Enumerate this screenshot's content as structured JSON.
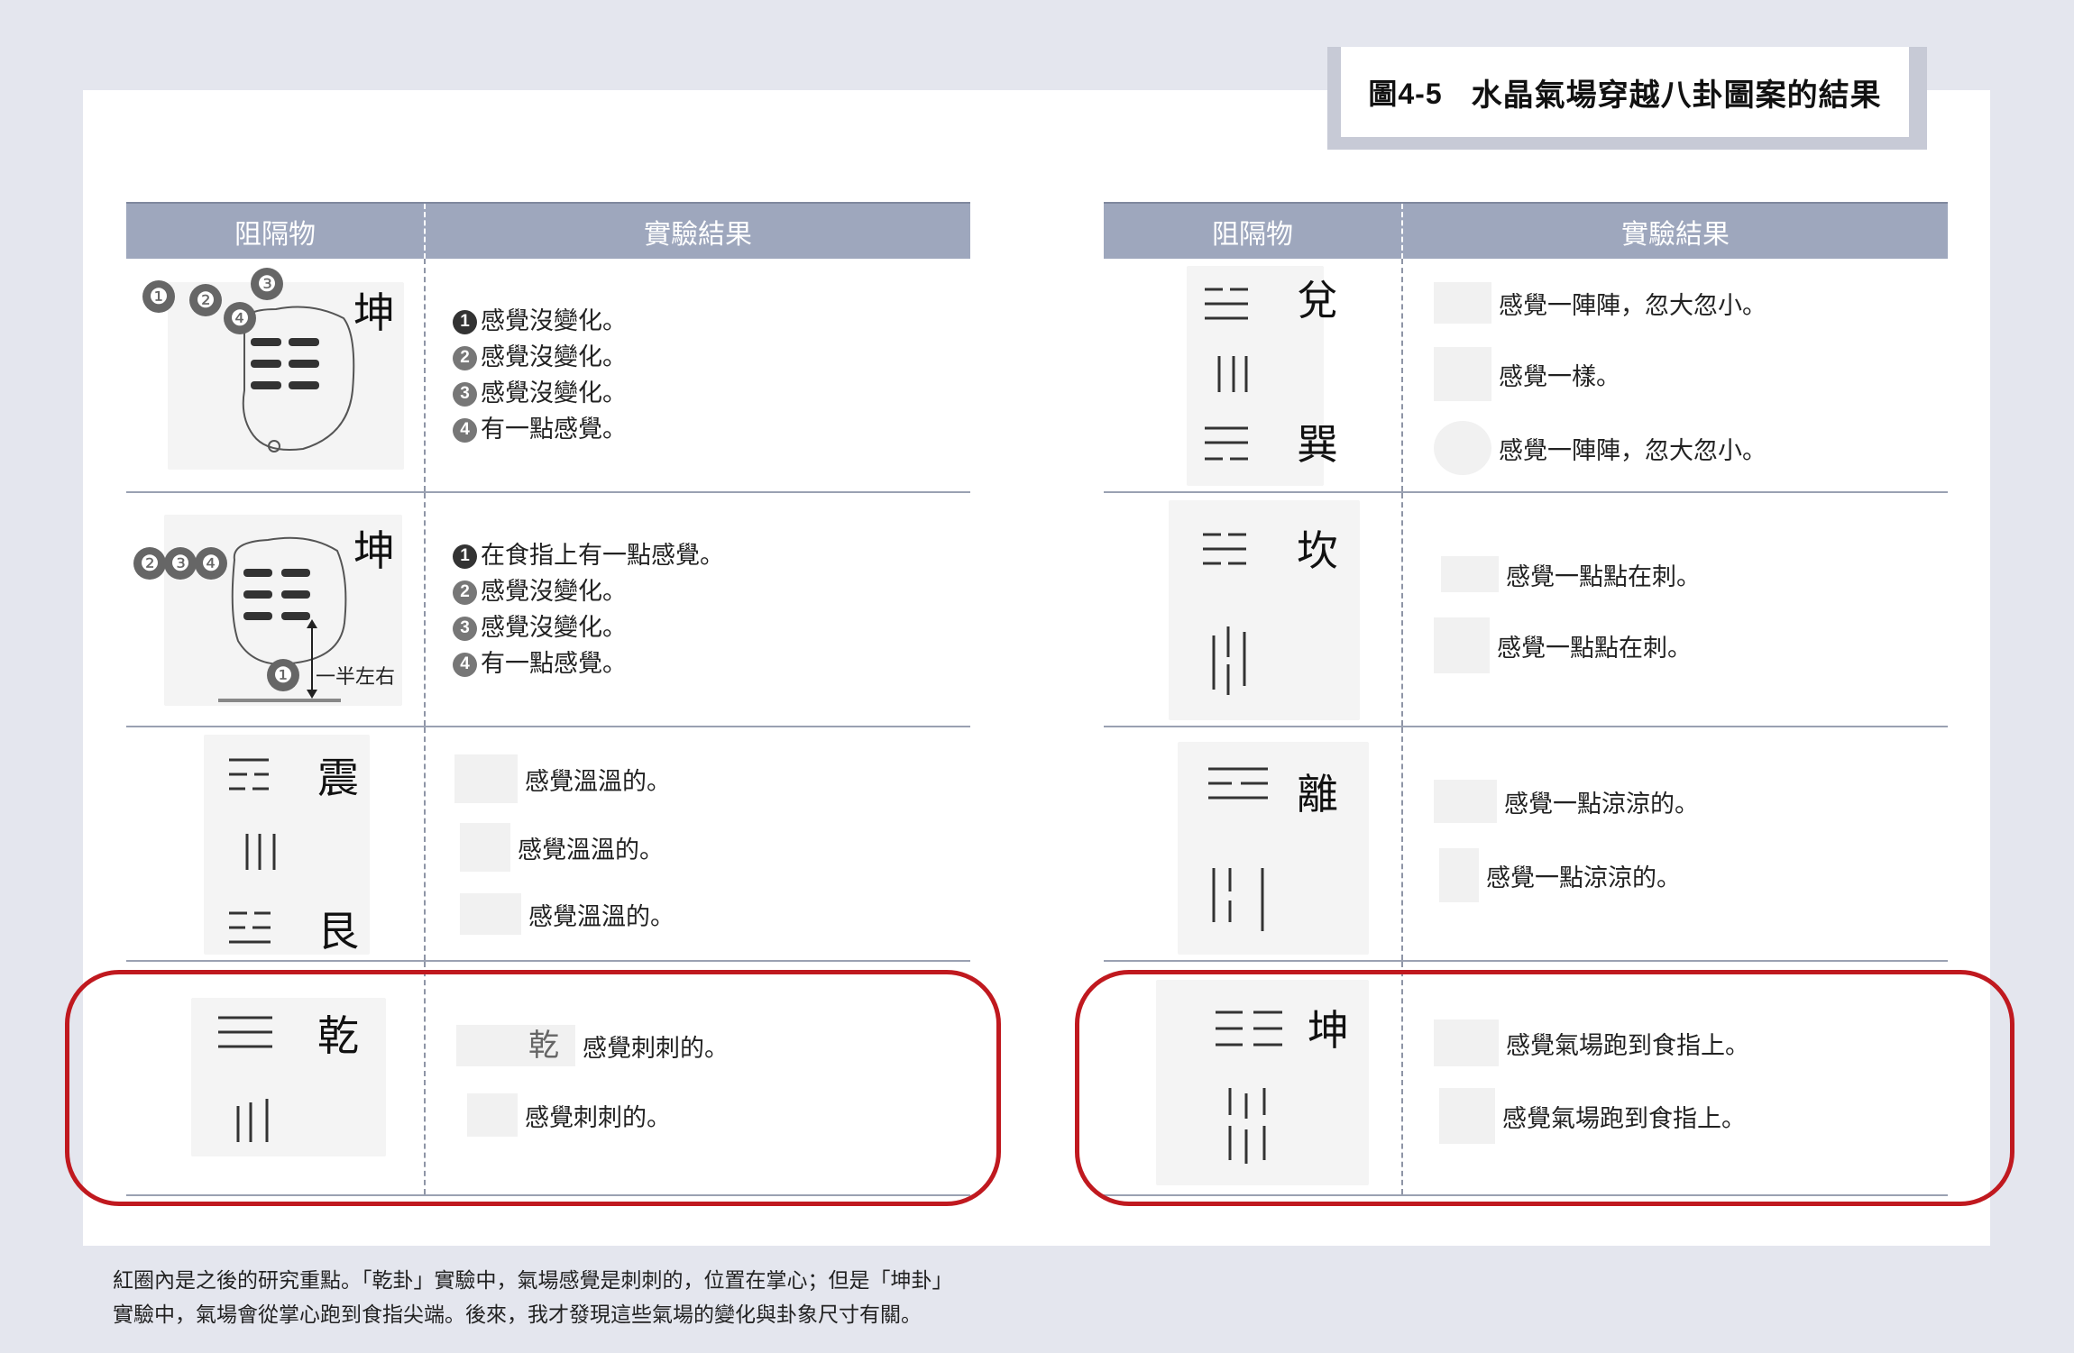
{
  "figure": {
    "number": "圖4-5",
    "title": "水晶氣場穿越八卦圖案的結果"
  },
  "left_table": {
    "headers": [
      "阻隔物",
      "實驗結果"
    ],
    "rows": [
      {
        "trigram": "坤",
        "markers": [
          "❶",
          "❷",
          "❸",
          "❹"
        ],
        "results": [
          {
            "num": "1",
            "text": "感覺沒變化。"
          },
          {
            "num": "2",
            "text": "感覺沒變化。"
          },
          {
            "num": "3",
            "text": "感覺沒變化。"
          },
          {
            "num": "4",
            "text": "有一點感覺。"
          }
        ]
      },
      {
        "trigram": "坤",
        "markers": [
          "❷",
          "❸",
          "❹",
          "❶"
        ],
        "annotation": "一半左右",
        "results": [
          {
            "num": "1",
            "text": "在食指上有一點感覺。"
          },
          {
            "num": "2",
            "text": "感覺沒變化。"
          },
          {
            "num": "3",
            "text": "感覺沒變化。"
          },
          {
            "num": "4",
            "text": "有一點感覺。"
          }
        ]
      },
      {
        "trigrams": [
          "震",
          "艮"
        ],
        "results": [
          "感覺溫溫的。",
          "感覺溫溫的。",
          "感覺溫溫的。"
        ]
      },
      {
        "trigrams": [
          "乾"
        ],
        "symbol_label": "乾",
        "results": [
          "感覺刺刺的。",
          "感覺刺刺的。"
        ]
      }
    ]
  },
  "right_table": {
    "headers": [
      "阻隔物",
      "實驗結果"
    ],
    "rows": [
      {
        "trigrams": [
          "兌",
          "巽"
        ],
        "results": [
          "感覺一陣陣，忽大忽小。",
          "感覺一樣。",
          "感覺一陣陣，忽大忽小。"
        ]
      },
      {
        "trigrams": [
          "坎"
        ],
        "results": [
          "感覺一點點在刺。",
          "感覺一點點在刺。"
        ]
      },
      {
        "trigrams": [
          "離"
        ],
        "results": [
          "感覺一點涼涼的。",
          "感覺一點涼涼的。"
        ]
      },
      {
        "trigrams": [
          "坤"
        ],
        "results": [
          "感覺氣場跑到食指上。",
          "感覺氣場跑到食指上。"
        ]
      }
    ]
  },
  "caption": {
    "line1": "紅圈內是之後的研究重點。「乾卦」實驗中，氣場感覺是刺刺的，位置在掌心；但是「坤卦」",
    "line2": "實驗中，氣場會從掌心跑到食指尖端。後來，我才發現這些氣場的變化與卦象尺寸有關。"
  },
  "colors": {
    "header_bg": "#9ea7bd",
    "highlight": "#c0191f",
    "page_bg": "#e4e6ee"
  }
}
